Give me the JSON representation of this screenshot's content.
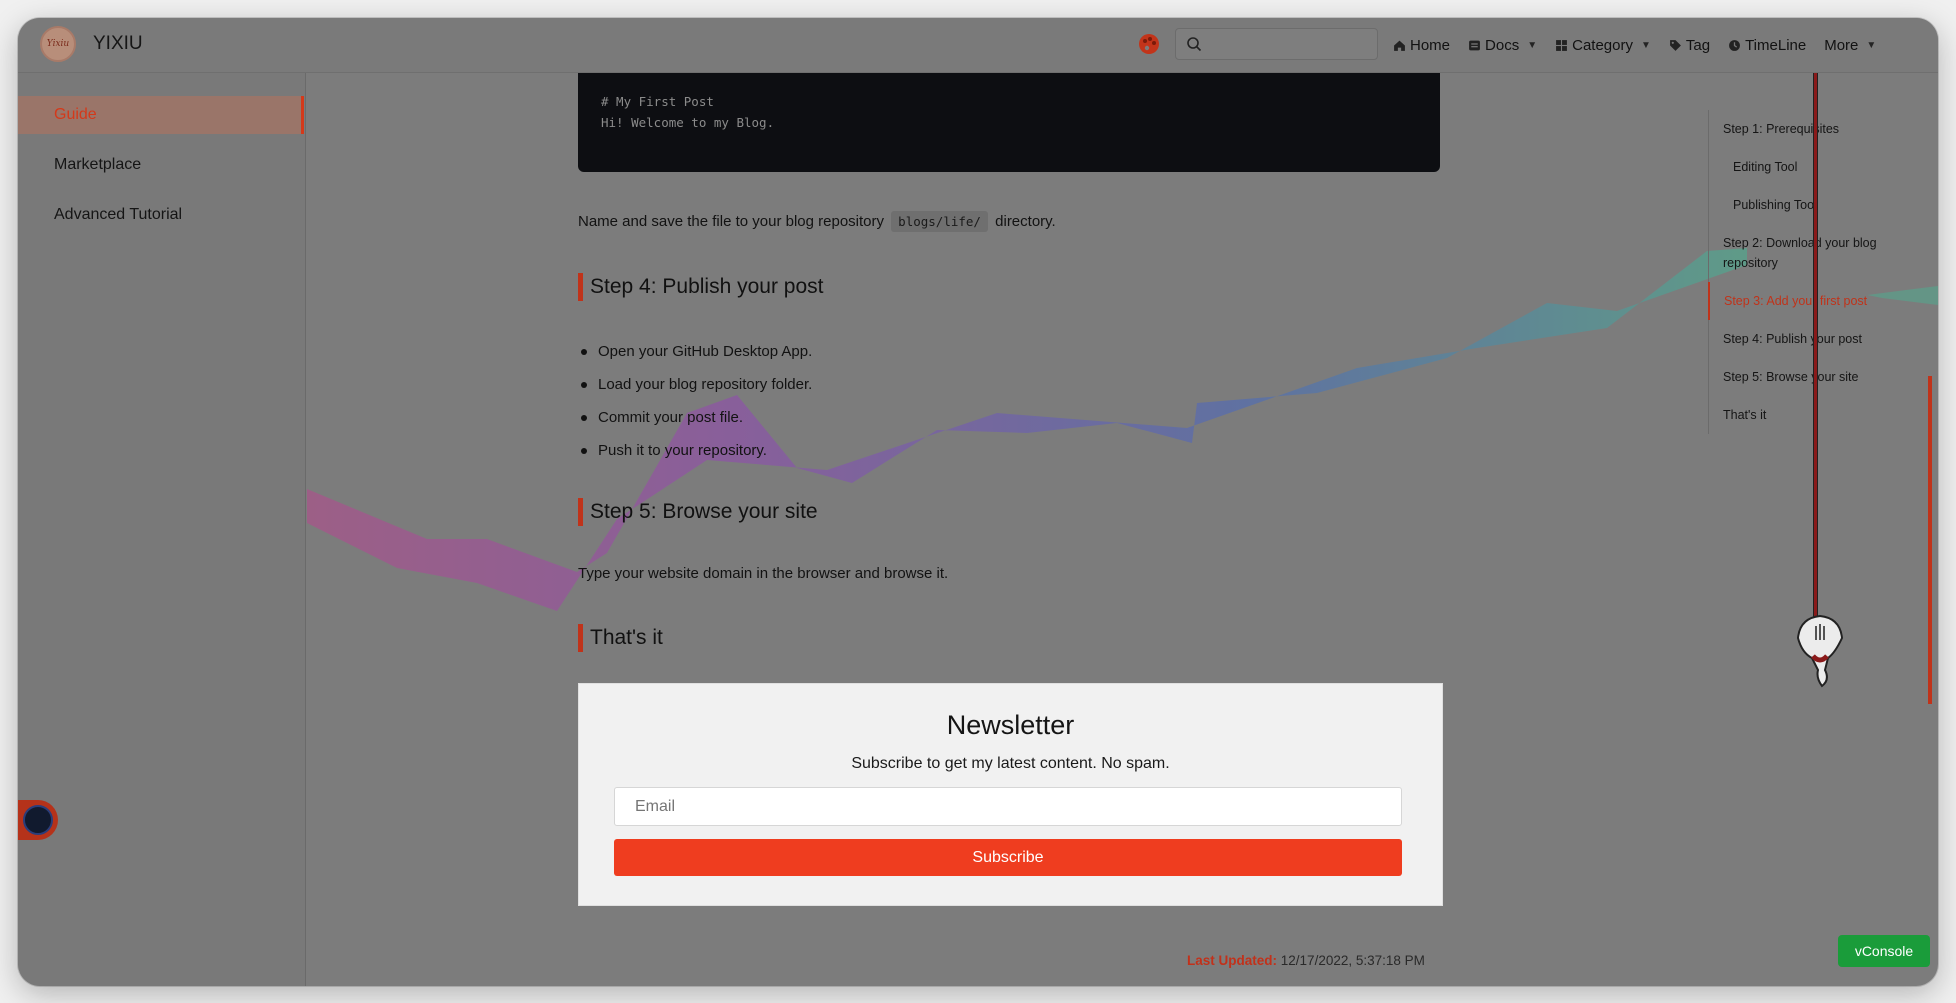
{
  "site": {
    "name": "YIXIU",
    "logo_text": "Yixiu"
  },
  "nav": {
    "search_placeholder": "",
    "items": [
      {
        "label": "Home",
        "icon": "home-icon"
      },
      {
        "label": "Docs",
        "icon": "docs-icon",
        "has_dropdown": true
      },
      {
        "label": "Category",
        "icon": "category-icon",
        "has_dropdown": true
      },
      {
        "label": "Tag",
        "icon": "tag-icon"
      },
      {
        "label": "TimeLine",
        "icon": "timeline-icon"
      },
      {
        "label": "More",
        "has_dropdown": true
      }
    ]
  },
  "sidebar": {
    "items": [
      {
        "label": "Guide",
        "active": true
      },
      {
        "label": "Marketplace"
      },
      {
        "label": "Advanced Tutorial"
      }
    ]
  },
  "content": {
    "code_lines": [
      "# My First Post",
      "Hi! Welcome to my Blog."
    ],
    "save_text_before": "Name and save the file to your blog repository",
    "save_text_code": "blogs/life/",
    "save_text_after": "directory.",
    "step4_heading": "Step 4: Publish your post",
    "step4_bullets": [
      "Open your GitHub Desktop App.",
      "Load your blog repository folder.",
      "Commit your post file.",
      "Push it to your repository."
    ],
    "step5_heading": "Step 5: Browse your site",
    "step5_text": "Type your website domain in the browser and browse it.",
    "thats_it_heading": "That's it"
  },
  "newsletter": {
    "title": "Newsletter",
    "subtitle": "Subscribe to get my latest content. No spam.",
    "email_placeholder": "Email",
    "button_label": "Subscribe"
  },
  "last_updated": {
    "label": "Last Updated:",
    "value": "12/17/2022, 5:37:18 PM"
  },
  "toc": {
    "items": [
      {
        "label": "Step 1: Prerequisites"
      },
      {
        "label": "Editing Tool",
        "sub": true
      },
      {
        "label": "Publishing Tool",
        "sub": true
      },
      {
        "label": "Step 2: Download your blog repository"
      },
      {
        "label": "Step 3: Add your first post",
        "active": true
      },
      {
        "label": "Step 4: Publish your post"
      },
      {
        "label": "Step 5: Browse your site"
      },
      {
        "label": "That's it"
      }
    ]
  },
  "vconsole_label": "vConsole",
  "colors": {
    "accent": "#ef3d1f",
    "overlay": "#7c7c7c",
    "vconsole": "#1a9c3a"
  }
}
